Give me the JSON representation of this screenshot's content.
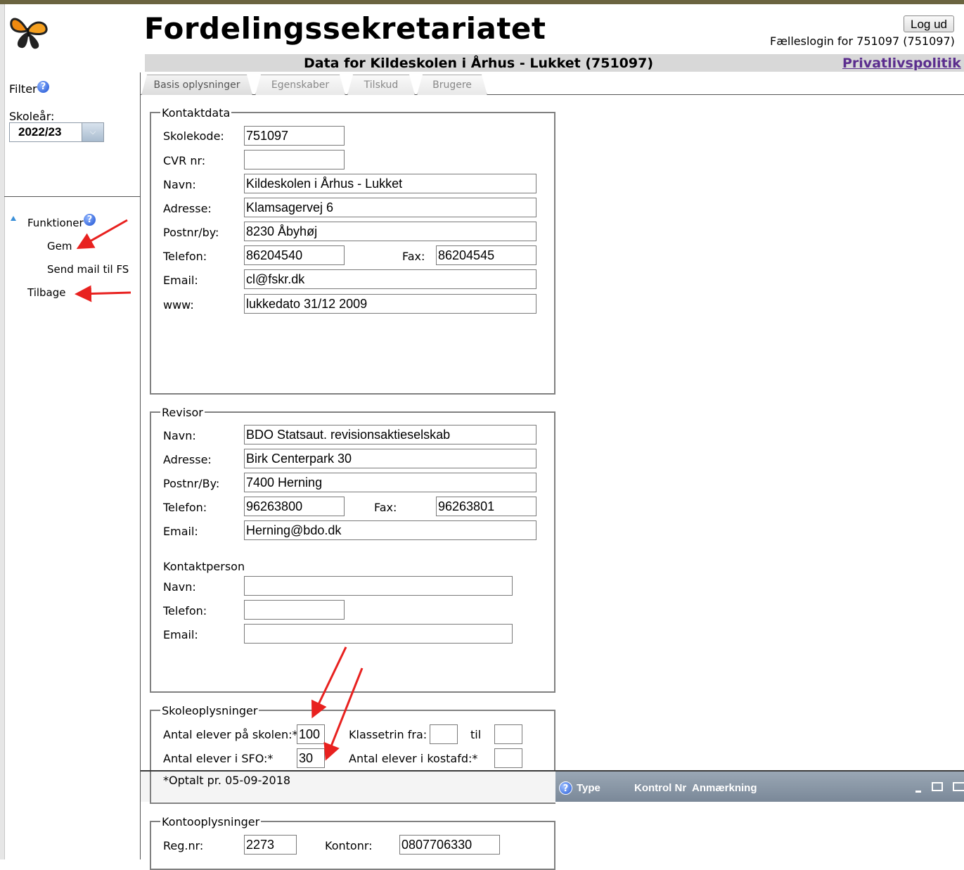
{
  "header": {
    "app_title": "Fordelingssekretariatet",
    "logout_label": "Log ud",
    "login_info": "Fælleslogin for 751097 (751097)",
    "subtitle": "Data for Kildeskolen i Århus - Lukket (751097)",
    "privacy_link": "Privatlivspolitik"
  },
  "sidebar": {
    "filter_label": "Filter",
    "schoolyear_label": "Skoleår:",
    "schoolyear_value": "2022/23",
    "functions_label": "Funktioner",
    "items": [
      "Gem",
      "Send mail til FS",
      "Tilbage"
    ]
  },
  "tabs": [
    "Basis oplysninger",
    "Egenskaber",
    "Tilskud",
    "Brugere"
  ],
  "contact": {
    "legend": "Kontaktdata",
    "labels": {
      "skolekode": "Skolekode:",
      "cvr": "CVR nr:",
      "navn": "Navn:",
      "adresse": "Adresse:",
      "postnr": "Postnr/by:",
      "telefon": "Telefon:",
      "fax": "Fax:",
      "email": "Email:",
      "www": "www:"
    },
    "values": {
      "skolekode": "751097",
      "cvr": "",
      "navn": "Kildeskolen i Århus - Lukket",
      "adresse": "Klamsagervej 6",
      "postnr": "8230 Åbyhøj",
      "telefon": "86204540",
      "fax": "86204545",
      "email": "cl@fskr.dk",
      "www": "lukkedato 31/12 2009"
    }
  },
  "revisor": {
    "legend": "Revisor",
    "labels": {
      "navn": "Navn:",
      "adresse": "Adresse:",
      "postnr": "Postnr/By:",
      "telefon": "Telefon:",
      "fax": "Fax:",
      "email": "Email:"
    },
    "values": {
      "navn": "BDO Statsaut. revisionsaktieselskab",
      "adresse": "Birk Centerpark 30",
      "postnr": "7400 Herning",
      "telefon": "96263800",
      "fax": "96263801",
      "email": "Herning@bdo.dk"
    },
    "contact_heading": "Kontaktperson",
    "contact_labels": {
      "navn": "Navn:",
      "telefon": "Telefon:",
      "email": "Email:"
    },
    "contact_values": {
      "navn": "",
      "telefon": "",
      "email": ""
    }
  },
  "school": {
    "legend": "Skoleoplysninger",
    "labels": {
      "elever": "Antal elever på skolen:*",
      "klassetrin_fra": "Klassetrin fra:",
      "til": "til",
      "sfo": "Antal elever i SFO:*",
      "kostafd": "Antal elever i kostafd:*"
    },
    "values": {
      "elever": "100",
      "klassetrin_fra": "",
      "til": "",
      "sfo": "30",
      "kostafd": ""
    },
    "note": "*Optalt pr. 05-09-2018"
  },
  "account": {
    "legend": "Kontooplysninger",
    "labels": {
      "regnr": "Reg.nr:",
      "kontonr": "Kontonr:"
    },
    "values": {
      "regnr": "2273",
      "kontonr": "0807706330"
    }
  },
  "grid": {
    "columns": [
      "Type",
      "Kontrol Nr",
      "Anmærkning"
    ]
  },
  "colors": {
    "annotation_arrow": "#e8211f",
    "privacy_link": "#5b2d8e",
    "grid_header": "#8595a6"
  }
}
